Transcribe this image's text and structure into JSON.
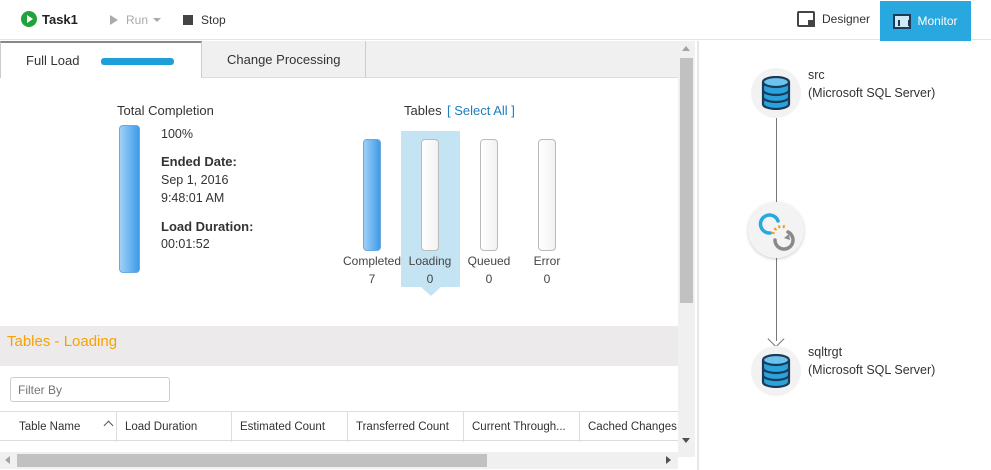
{
  "toolbar": {
    "task_name": "Task1",
    "run_label": "Run",
    "stop_label": "Stop",
    "designer_label": "Designer",
    "monitor_label": "Monitor"
  },
  "tabs": {
    "full_load": "Full Load",
    "change_processing": "Change Processing"
  },
  "summary": {
    "total_completion_label": "Total Completion",
    "percent": "100%",
    "ended_date_label": "Ended Date:",
    "ended_date": "Sep 1, 2016",
    "ended_time": "9:48:01 AM",
    "load_duration_label": "Load Duration:",
    "load_duration": "00:01:52"
  },
  "tables": {
    "label": "Tables",
    "select_all": "[ Select All ]",
    "items": [
      {
        "label": "Completed",
        "count": "7"
      },
      {
        "label": "Loading",
        "count": "0"
      },
      {
        "label": "Queued",
        "count": "0"
      },
      {
        "label": "Error",
        "count": "0"
      }
    ]
  },
  "loading_section": {
    "title": "Tables - Loading",
    "filter_placeholder": "Filter By",
    "columns": [
      "Table Name",
      "Load Duration",
      "Estimated Count",
      "Transferred Count",
      "Current Through...",
      "Cached Changes"
    ]
  },
  "flow": {
    "source": {
      "name": "src",
      "type": "(Microsoft SQL Server)"
    },
    "target": {
      "name": "sqltrgt",
      "type": "(Microsoft SQL Server)"
    }
  },
  "colors": {
    "accent": "#29a8e0",
    "progress": "#3f9be8",
    "section_title": "#f7a200",
    "run_icon": "#1fa33a"
  }
}
